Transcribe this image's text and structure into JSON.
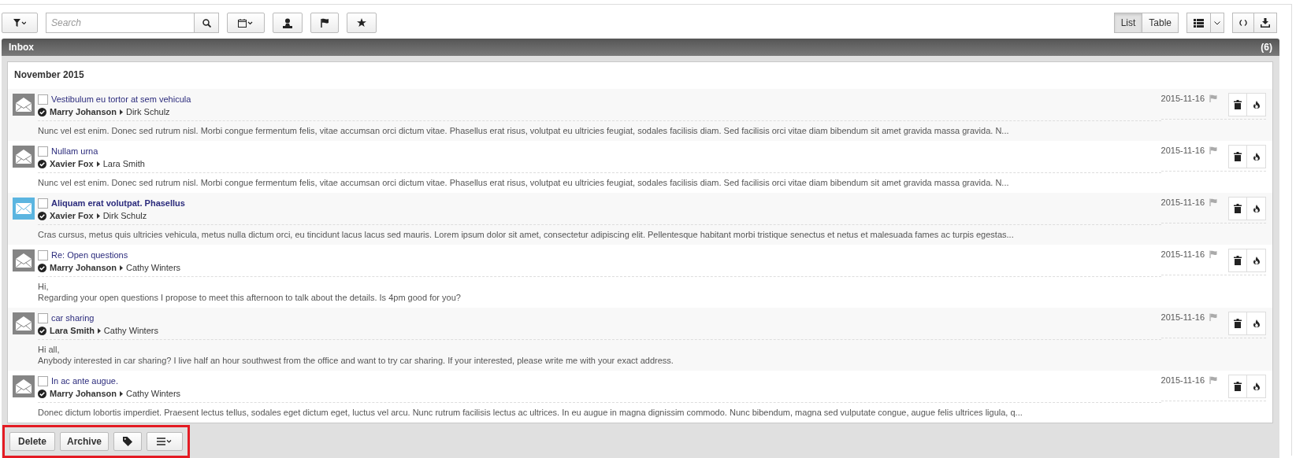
{
  "toolbar": {
    "search": {
      "placeholder": "Search"
    },
    "views": [
      {
        "label": "List",
        "selected": true
      },
      {
        "label": "Table",
        "selected": false
      }
    ]
  },
  "inbox": {
    "title": "Inbox",
    "count": "(6)",
    "group": "November 2015",
    "messages": [
      {
        "subject": "Vestibulum eu tortor at sem vehicula",
        "from": "Marry Johanson",
        "to": "Dirk Schulz",
        "date": "2015-11-16",
        "unread": false,
        "checked": false,
        "flagged": false,
        "body": [
          "Nunc vel est enim. Donec sed rutrum nisl. Morbi congue fermentum felis, vitae accumsan orci dictum vitae. Phasellus erat risus, volutpat eu ultricies feugiat, sodales facilisis diam. Sed facilisis orci vitae diam bibendum sit amet gravida massa gravida. N..."
        ]
      },
      {
        "subject": "Nullam urna",
        "from": "Xavier Fox",
        "to": "Lara Smith",
        "date": "2015-11-16",
        "unread": false,
        "checked": false,
        "flagged": false,
        "body": [
          "Nunc vel est enim. Donec sed rutrum nisl. Morbi congue fermentum felis, vitae accumsan orci dictum vitae. Phasellus erat risus, volutpat eu ultricies feugiat, sodales facilisis diam. Sed facilisis orci vitae diam bibendum sit amet gravida massa gravida. N..."
        ]
      },
      {
        "subject": "Aliquam erat volutpat. Phasellus",
        "from": "Xavier Fox",
        "to": "Dirk Schulz",
        "date": "2015-11-16",
        "unread": true,
        "checked": false,
        "flagged": false,
        "body": [
          "Cras cursus, metus quis ultricies vehicula, metus nulla dictum orci, eu tincidunt lacus lacus sed mauris. Lorem ipsum dolor sit amet, consectetur adipiscing elit. Pellentesque habitant morbi tristique senectus et netus et malesuada fames ac turpis egestas..."
        ]
      },
      {
        "subject": "Re: Open questions",
        "from": "Marry Johanson",
        "to": "Cathy Winters",
        "date": "2015-11-16",
        "unread": false,
        "checked": false,
        "flagged": false,
        "body": [
          "Hi,",
          "Regarding your open questions I propose to meet this afternoon to talk about the details. Is 4pm good for you?"
        ]
      },
      {
        "subject": "car sharing",
        "from": "Lara Smith",
        "to": "Cathy Winters",
        "date": "2015-11-16",
        "unread": false,
        "checked": false,
        "flagged": false,
        "body": [
          "Hi all,",
          "Anybody interested in car sharing? I live half an hour southwest from the office and want to try car sharing. If your interested, please write me with your exact address."
        ]
      },
      {
        "subject": "In ac ante augue.",
        "from": "Marry Johanson",
        "to": "Cathy Winters",
        "date": "2015-11-16",
        "unread": false,
        "checked": false,
        "flagged": false,
        "body": [
          "Donec dictum lobortis imperdiet. Praesent lectus tellus, sodales eget dictum eget, luctus vel arcu. Nunc rutrum facilisis lectus ac ultrices. In eu augue in magna dignissim commodo. Nunc bibendum, magna sed vulputate congue, augue felis ultrices ligula, q..."
        ]
      }
    ]
  },
  "footer": {
    "buttons": [
      "Delete",
      "Archive"
    ],
    "highlighted": true
  }
}
